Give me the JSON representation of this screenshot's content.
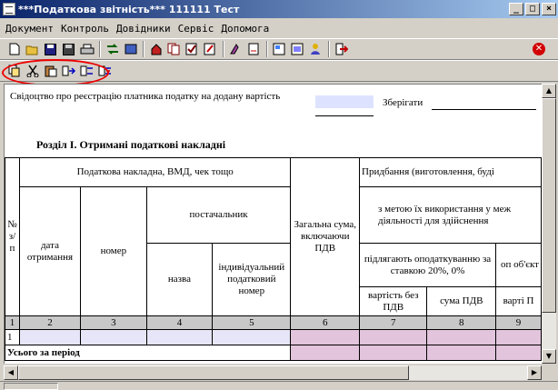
{
  "window": {
    "title": "***Податкова звітність*** 111111 Тест",
    "min_label": "_",
    "max_label": "□",
    "close_label": "×"
  },
  "menu": [
    "Документ",
    "Контроль",
    "Довідники",
    "Сервіс",
    "Допомога"
  ],
  "toolbar1": {
    "icons": [
      "new-doc-icon",
      "open-folder-icon",
      "save-icon",
      "save-as-icon",
      "print-icon",
      "transfer-icon",
      "import-icon",
      "export-icon",
      "copy-doc-icon",
      "check-icon",
      "edit-icon",
      "list-icon",
      "settings-icon",
      "preview-icon",
      "help-icon",
      "exit-icon"
    ],
    "close_label": "✕"
  },
  "toolbar2": {
    "icons": [
      "copy-rows-icon",
      "cut-icon",
      "paste-icon",
      "insert-row-icon",
      "split-row-icon",
      "delete-row-icon"
    ]
  },
  "form": {
    "certificate_text": "Свідоцтво про реєстрацію платника податку на додану вартість",
    "keep_label": "Зберігати",
    "section_title": "Розділ I. Отримані податкові накладні",
    "headers": {
      "col_no": "№ з/п",
      "invoice_group": "Податкова накладна, ВМД, чек тощо",
      "date": "дата отримання",
      "number": "номер",
      "supplier": "постачальник",
      "name": "назва",
      "tax_number": "індивідуальний податковий номер",
      "total": "Загальна сума, включаючи ПДВ",
      "purchase": "Придбання (виготовлення, буді",
      "purpose": "з метою їх використання у меж діяльності для здійснення",
      "taxable": "підлягають оподаткуванню за ставкою 20%, 0%",
      "op_partial": "оп об'єкт",
      "value_no_vat": "вартість без ПДВ",
      "vat_sum": "сума ПДВ",
      "value_partial": "варті П"
    },
    "column_numbers": [
      "1",
      "2",
      "3",
      "4",
      "5",
      "6",
      "7",
      "8",
      "9"
    ],
    "first_row_no": "1",
    "total_label": "Усього за період"
  }
}
